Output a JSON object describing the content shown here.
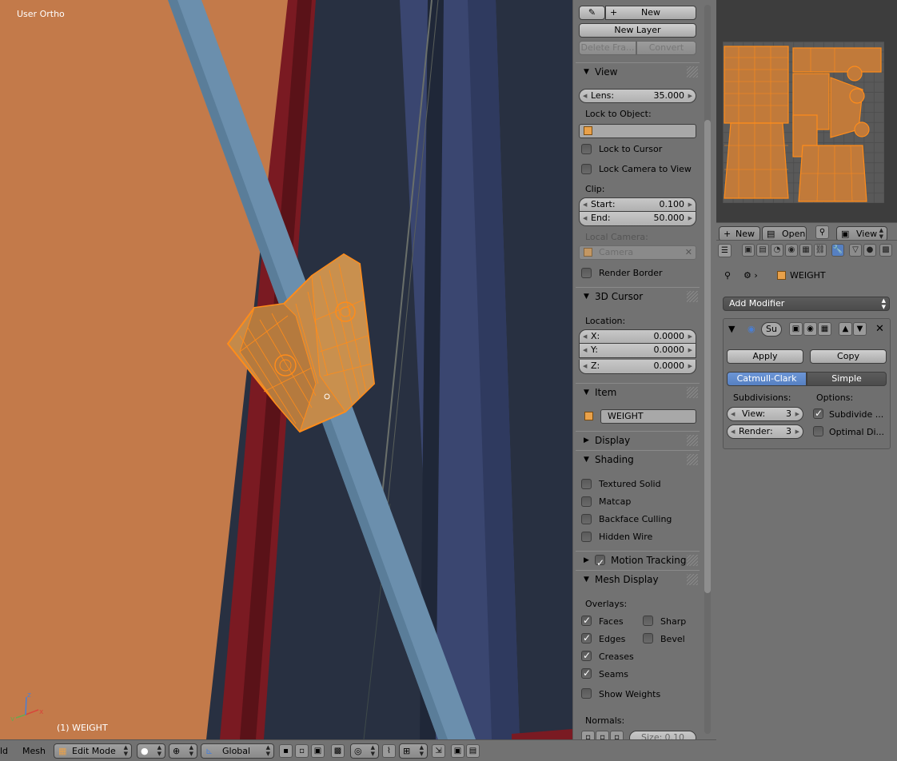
{
  "viewport": {
    "title": "User Ortho",
    "object_label": "(1) WEIGHT",
    "axis_x": "x",
    "axis_y": "y",
    "axis_z": "z"
  },
  "grease_pencil": {
    "new_label": "New",
    "new_layer_label": "New Layer",
    "delete_frame_label": "Delete Fra...",
    "convert_label": "Convert"
  },
  "view_panel": {
    "header": "View",
    "lens_label": "Lens:",
    "lens_value": "35.000",
    "lock_to_object_label": "Lock to Object:",
    "lock_to_cursor_label": "Lock to Cursor",
    "lock_camera_label": "Lock Camera to View",
    "clip_label": "Clip:",
    "start_label": "Start:",
    "start_value": "0.100",
    "end_label": "End:",
    "end_value": "50.000",
    "local_camera_label": "Local Camera:",
    "camera_value": "Camera",
    "render_border_label": "Render Border"
  },
  "cursor_panel": {
    "header": "3D Cursor",
    "location_label": "Location:",
    "x_label": "X:",
    "x_value": "0.0000",
    "y_label": "Y:",
    "y_value": "0.0000",
    "z_label": "Z:",
    "z_value": "0.0000"
  },
  "item_panel": {
    "header": "Item",
    "name": "WEIGHT"
  },
  "display_panel": {
    "header": "Display"
  },
  "shading_panel": {
    "header": "Shading",
    "textured_solid": "Textured Solid",
    "matcap": "Matcap",
    "backface_culling": "Backface Culling",
    "hidden_wire": "Hidden Wire"
  },
  "motion_tracking_panel": {
    "header": "Motion Tracking"
  },
  "mesh_display_panel": {
    "header": "Mesh Display",
    "overlays_label": "Overlays:",
    "faces": "Faces",
    "sharp": "Sharp",
    "edges": "Edges",
    "bevel": "Bevel",
    "creases": "Creases",
    "seams": "Seams",
    "show_weights": "Show Weights",
    "normals_label": "Normals:",
    "size_label": "Size:",
    "size_value": "0.10"
  },
  "uv_header": {
    "new_label": "New",
    "open_label": "Open",
    "view_label": "View"
  },
  "properties": {
    "object_name": "WEIGHT",
    "add_modifier_label": "Add Modifier",
    "modifier_name": "Su",
    "apply_label": "Apply",
    "copy_label": "Copy",
    "catmull_clark_label": "Catmull-Clark",
    "simple_label": "Simple",
    "subdivisions_label": "Subdivisions:",
    "options_label": "Options:",
    "view_label": "View:",
    "view_value": "3",
    "render_label": "Render:",
    "render_value": "3",
    "subdivide_uvs_label": "Subdivide ...",
    "optimal_display_label": "Optimal Di..."
  },
  "bottom_bar": {
    "view_label": "ld",
    "mesh_label": "Mesh",
    "mode_label": "Edit Mode",
    "orientation_label": "Global"
  },
  "colors": {
    "viewport_bg": "#283041",
    "wall_orange": "#c37a4a",
    "rod_blue": "#6b8fad",
    "selection_orange": "#ff8c1a",
    "active_tab_blue": "#5680c2"
  }
}
